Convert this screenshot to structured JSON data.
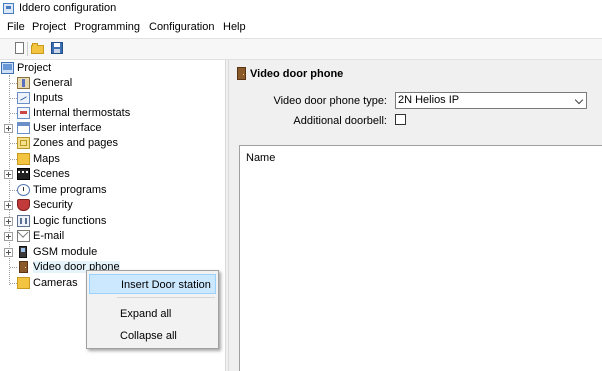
{
  "window": {
    "title": "Iddero configuration"
  },
  "menu": {
    "items": [
      {
        "label": "File"
      },
      {
        "label": "Project"
      },
      {
        "label": "Programming"
      },
      {
        "label": "Configuration"
      },
      {
        "label": "Help"
      }
    ]
  },
  "toolbar": {
    "buttons": [
      {
        "icon": "new-document-icon"
      },
      {
        "icon": "open-folder-icon"
      },
      {
        "icon": "save-disk-icon"
      }
    ]
  },
  "tree": {
    "root": "Project",
    "items": [
      {
        "label": "General",
        "icon": "general-icon",
        "expandable": false
      },
      {
        "label": "Inputs",
        "icon": "inputs-icon",
        "expandable": false
      },
      {
        "label": "Internal thermostats",
        "icon": "thermostat-icon",
        "expandable": false
      },
      {
        "label": "User interface",
        "icon": "user-interface-icon",
        "expandable": true
      },
      {
        "label": "Zones and pages",
        "icon": "zones-icon",
        "expandable": false
      },
      {
        "label": "Maps",
        "icon": "maps-icon",
        "expandable": false
      },
      {
        "label": "Scenes",
        "icon": "scenes-icon",
        "expandable": true
      },
      {
        "label": "Time programs",
        "icon": "clock-icon",
        "expandable": false
      },
      {
        "label": "Security",
        "icon": "shield-icon",
        "expandable": true
      },
      {
        "label": "Logic functions",
        "icon": "logic-icon",
        "expandable": true
      },
      {
        "label": "E-mail",
        "icon": "email-icon",
        "expandable": true
      },
      {
        "label": "GSM module",
        "icon": "phone-icon",
        "expandable": true
      },
      {
        "label": "Video door phone",
        "icon": "door-icon",
        "expandable": false
      },
      {
        "label": "Cameras",
        "icon": "camera-folder-icon",
        "expandable": false
      }
    ]
  },
  "context_menu": {
    "items": [
      {
        "label": "Insert Door station",
        "highlighted": true
      },
      {
        "label": "Expand all",
        "highlighted": false
      },
      {
        "label": "Collapse all",
        "highlighted": false
      }
    ]
  },
  "panel": {
    "title": "Video door phone",
    "type_label": "Video door phone type:",
    "type_value": "2N Helios IP",
    "doorbell_label": "Additional doorbell:",
    "doorbell_checked": false,
    "list_header": "Name"
  }
}
